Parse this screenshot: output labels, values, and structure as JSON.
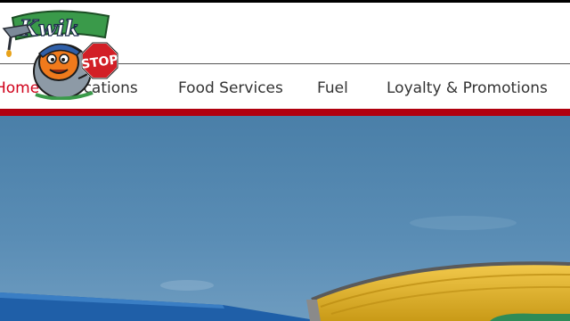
{
  "brand": {
    "name": "Kwik Stop",
    "wordmark": "Kwik",
    "stop_sign_text": "STOP"
  },
  "nav": {
    "items": [
      {
        "label": "Home",
        "active": true
      },
      {
        "label": "Locations",
        "active": false
      },
      {
        "label": "Food Services",
        "active": false
      },
      {
        "label": "Fuel",
        "active": false
      },
      {
        "label": "Loyalty & Promotions",
        "active": false
      }
    ]
  },
  "colors": {
    "accent_red": "#b0000e",
    "active_link": "#d0021b",
    "sky": "#4a7fa8",
    "logo_green": "#3a9a4a"
  },
  "icons": {
    "logo": "kwik-stop-mascot-logo",
    "hero": "gas-station-photo"
  }
}
